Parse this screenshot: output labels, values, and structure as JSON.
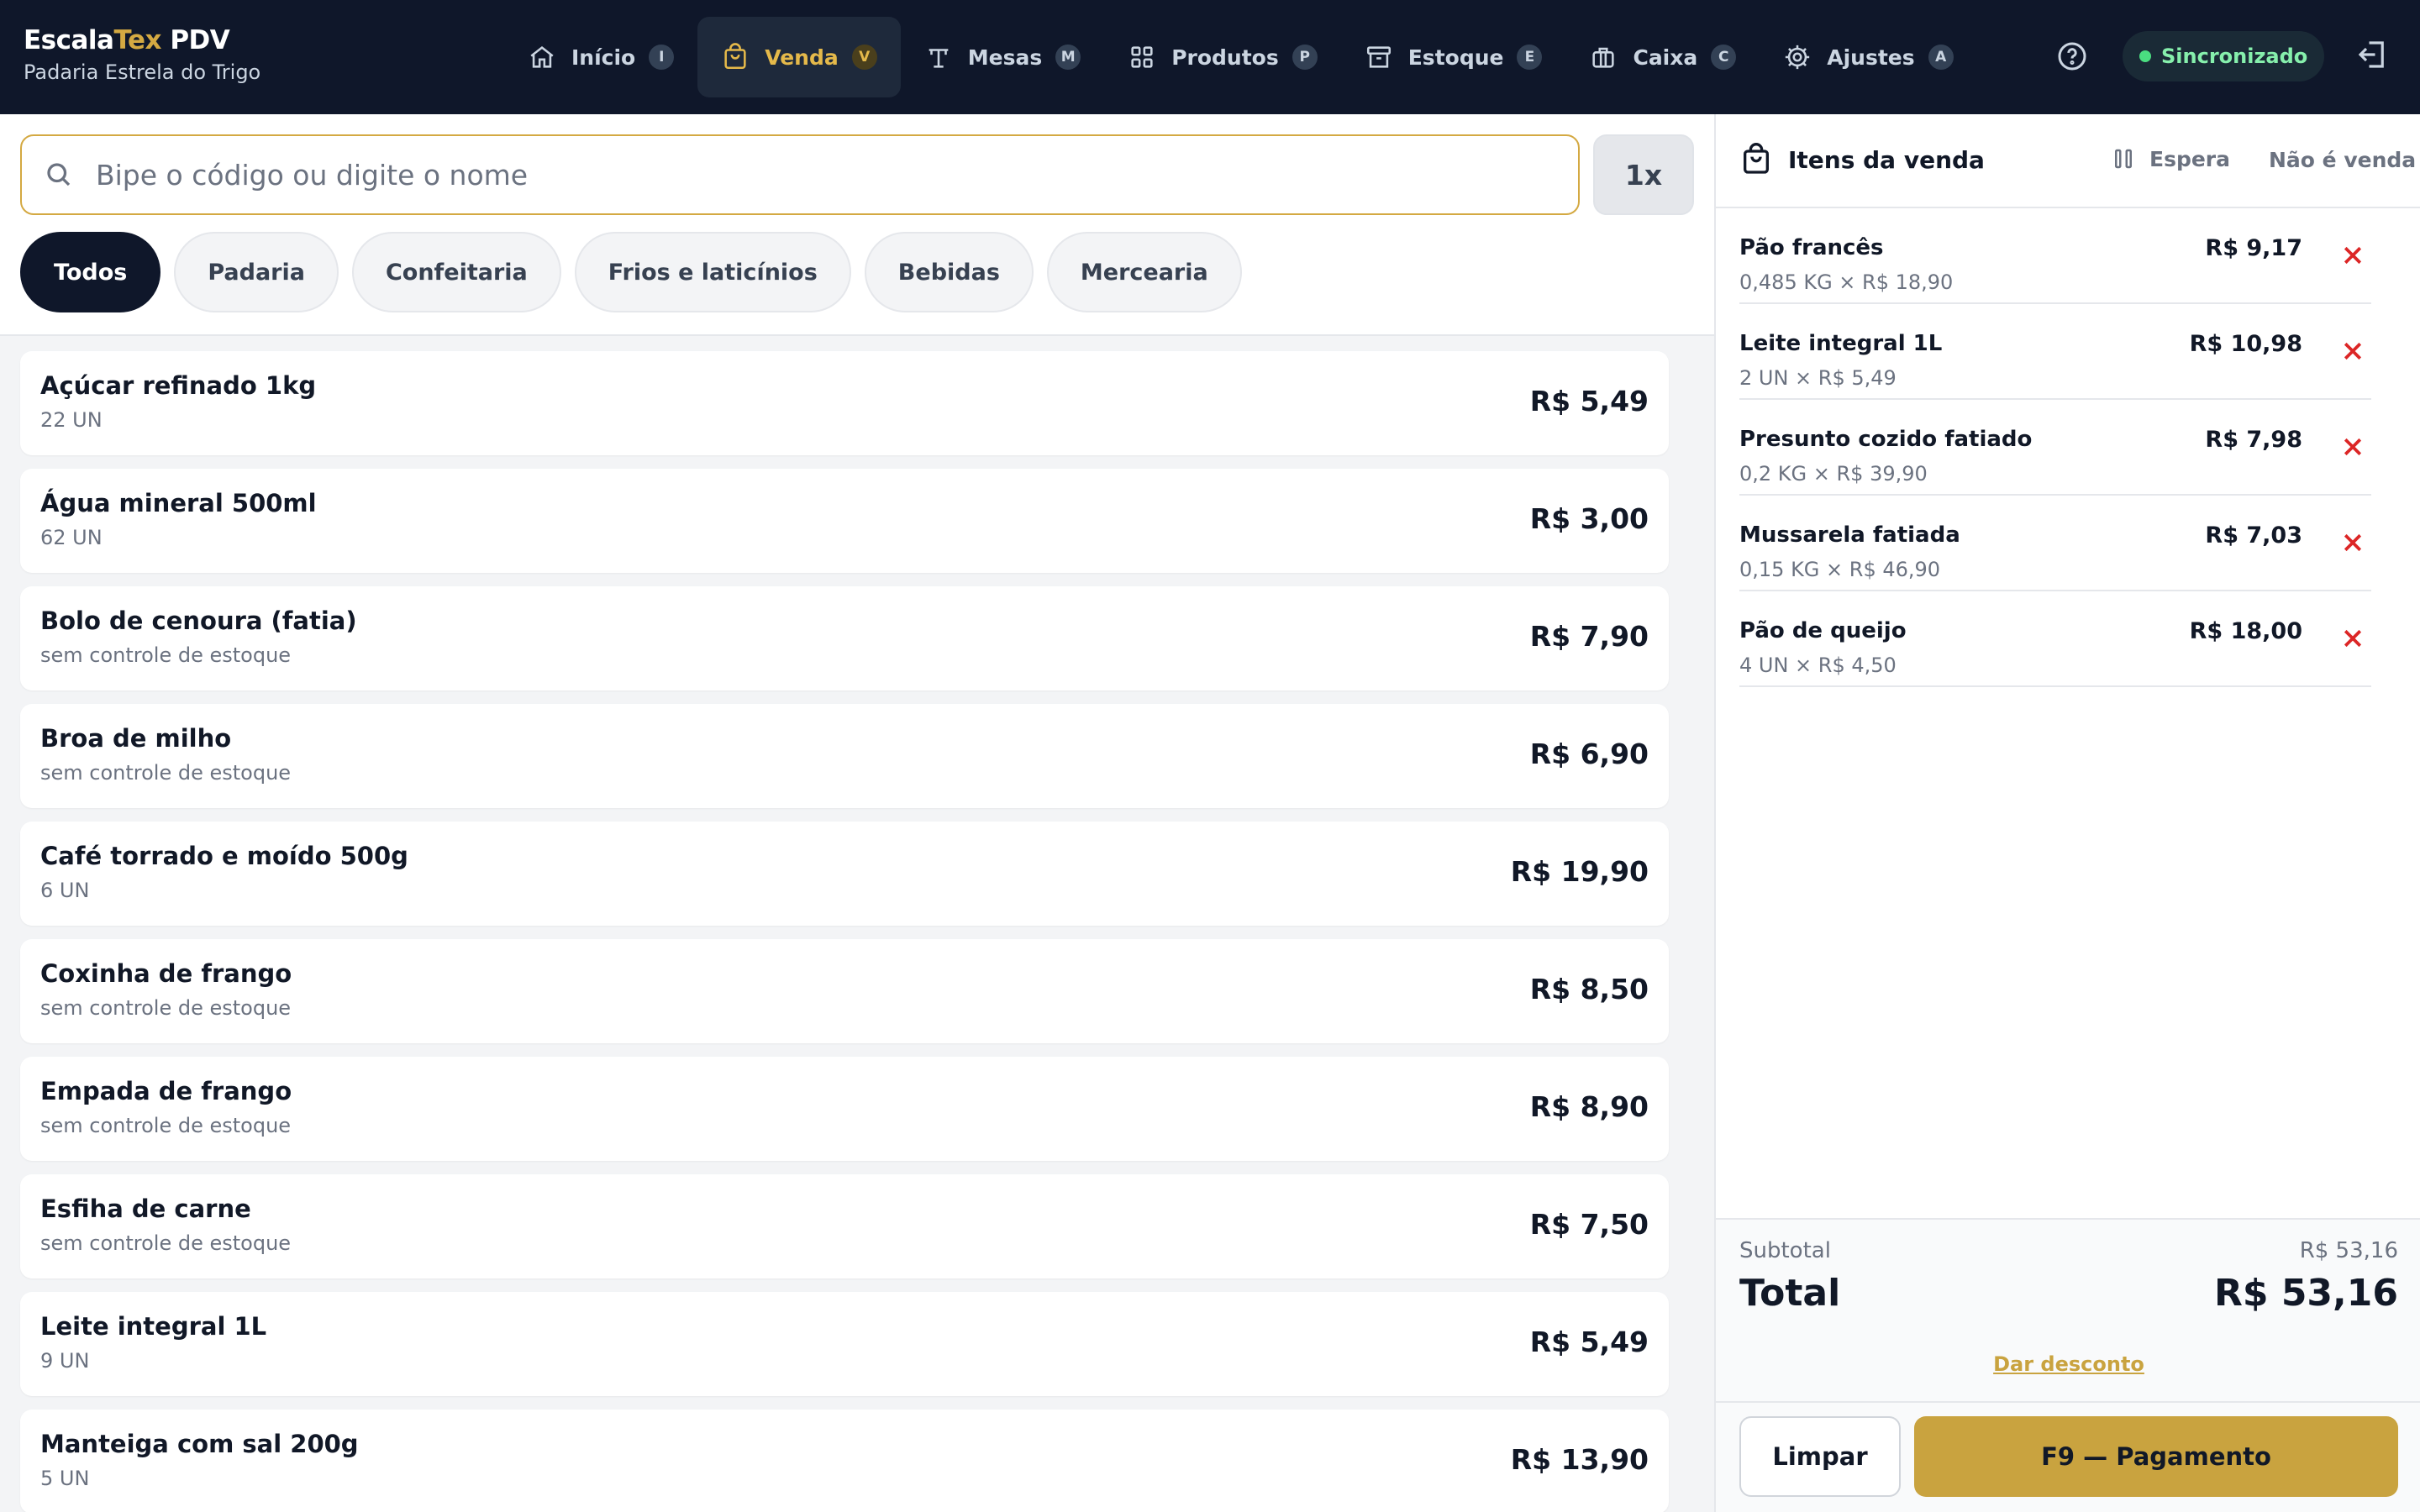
{
  "brand": {
    "name_part1": "Escala",
    "name_accent": "Tex",
    "name_part2": " PDV",
    "subtitle": "Padaria Estrela do Trigo"
  },
  "nav": [
    {
      "label": "Início",
      "key": "I",
      "icon": "home-icon",
      "active": false
    },
    {
      "label": "Venda",
      "key": "V",
      "icon": "shopping-bag-icon",
      "active": true
    },
    {
      "label": "Mesas",
      "key": "M",
      "icon": "table-icon",
      "active": false
    },
    {
      "label": "Produtos",
      "key": "P",
      "icon": "grid-icon",
      "active": false
    },
    {
      "label": "Estoque",
      "key": "E",
      "icon": "archive-icon",
      "active": false
    },
    {
      "label": "Caixa",
      "key": "C",
      "icon": "cash-register-icon",
      "active": false
    },
    {
      "label": "Ajustes",
      "key": "A",
      "icon": "gear-icon",
      "active": false
    }
  ],
  "status": {
    "sync_label": "Sincronizado",
    "sync_color": "#4ade80"
  },
  "search": {
    "placeholder": "Bipe o código ou digite o nome",
    "value": "",
    "quantity": "1x"
  },
  "categories": [
    {
      "label": "Todos",
      "active": true
    },
    {
      "label": "Padaria",
      "active": false
    },
    {
      "label": "Confeitaria",
      "active": false
    },
    {
      "label": "Frios e laticínios",
      "active": false
    },
    {
      "label": "Bebidas",
      "active": false
    },
    {
      "label": "Mercearia",
      "active": false
    }
  ],
  "products": [
    {
      "name": "Açúcar refinado 1kg",
      "stock": "22 UN",
      "price": "R$ 5,49"
    },
    {
      "name": "Água mineral 500ml",
      "stock": "62 UN",
      "price": "R$ 3,00"
    },
    {
      "name": "Bolo de cenoura (fatia)",
      "stock": "sem controle de estoque",
      "price": "R$ 7,90"
    },
    {
      "name": "Broa de milho",
      "stock": "sem controle de estoque",
      "price": "R$ 6,90"
    },
    {
      "name": "Café torrado e moído 500g",
      "stock": "6 UN",
      "price": "R$ 19,90"
    },
    {
      "name": "Coxinha de frango",
      "stock": "sem controle de estoque",
      "price": "R$ 8,50"
    },
    {
      "name": "Empada de frango",
      "stock": "sem controle de estoque",
      "price": "R$ 8,90"
    },
    {
      "name": "Esfiha de carne",
      "stock": "sem controle de estoque",
      "price": "R$ 7,50"
    },
    {
      "name": "Leite integral 1L",
      "stock": "9 UN",
      "price": "R$ 5,49"
    },
    {
      "name": "Manteiga com sal 200g",
      "stock": "5 UN",
      "price": "R$ 13,90"
    }
  ],
  "cart": {
    "title": "Itens da venda",
    "hold_label": "Espera",
    "not_sale_label": "Não é venda",
    "items": [
      {
        "name": "Pão francês",
        "detail": "0,485 KG × R$ 18,90",
        "total": "R$ 9,17"
      },
      {
        "name": "Leite integral 1L",
        "detail": "2 UN × R$ 5,49",
        "total": "R$ 10,98"
      },
      {
        "name": "Presunto cozido fatiado",
        "detail": "0,2 KG × R$ 39,90",
        "total": "R$ 7,98"
      },
      {
        "name": "Mussarela fatiada",
        "detail": "0,15 KG × R$ 46,90",
        "total": "R$ 7,03"
      },
      {
        "name": "Pão de queijo",
        "detail": "4 UN × R$ 4,50",
        "total": "R$ 18,00"
      }
    ],
    "subtotal_label": "Subtotal",
    "subtotal_value": "R$ 53,16",
    "total_label": "Total",
    "total_value": "R$ 53,16",
    "discount_label": "Dar desconto",
    "clear_label": "Limpar",
    "pay_label": "F9 — Pagamento"
  },
  "colors": {
    "accent": "#c9a33f",
    "nav_bg": "#0f172a",
    "remove": "#dc2626"
  }
}
